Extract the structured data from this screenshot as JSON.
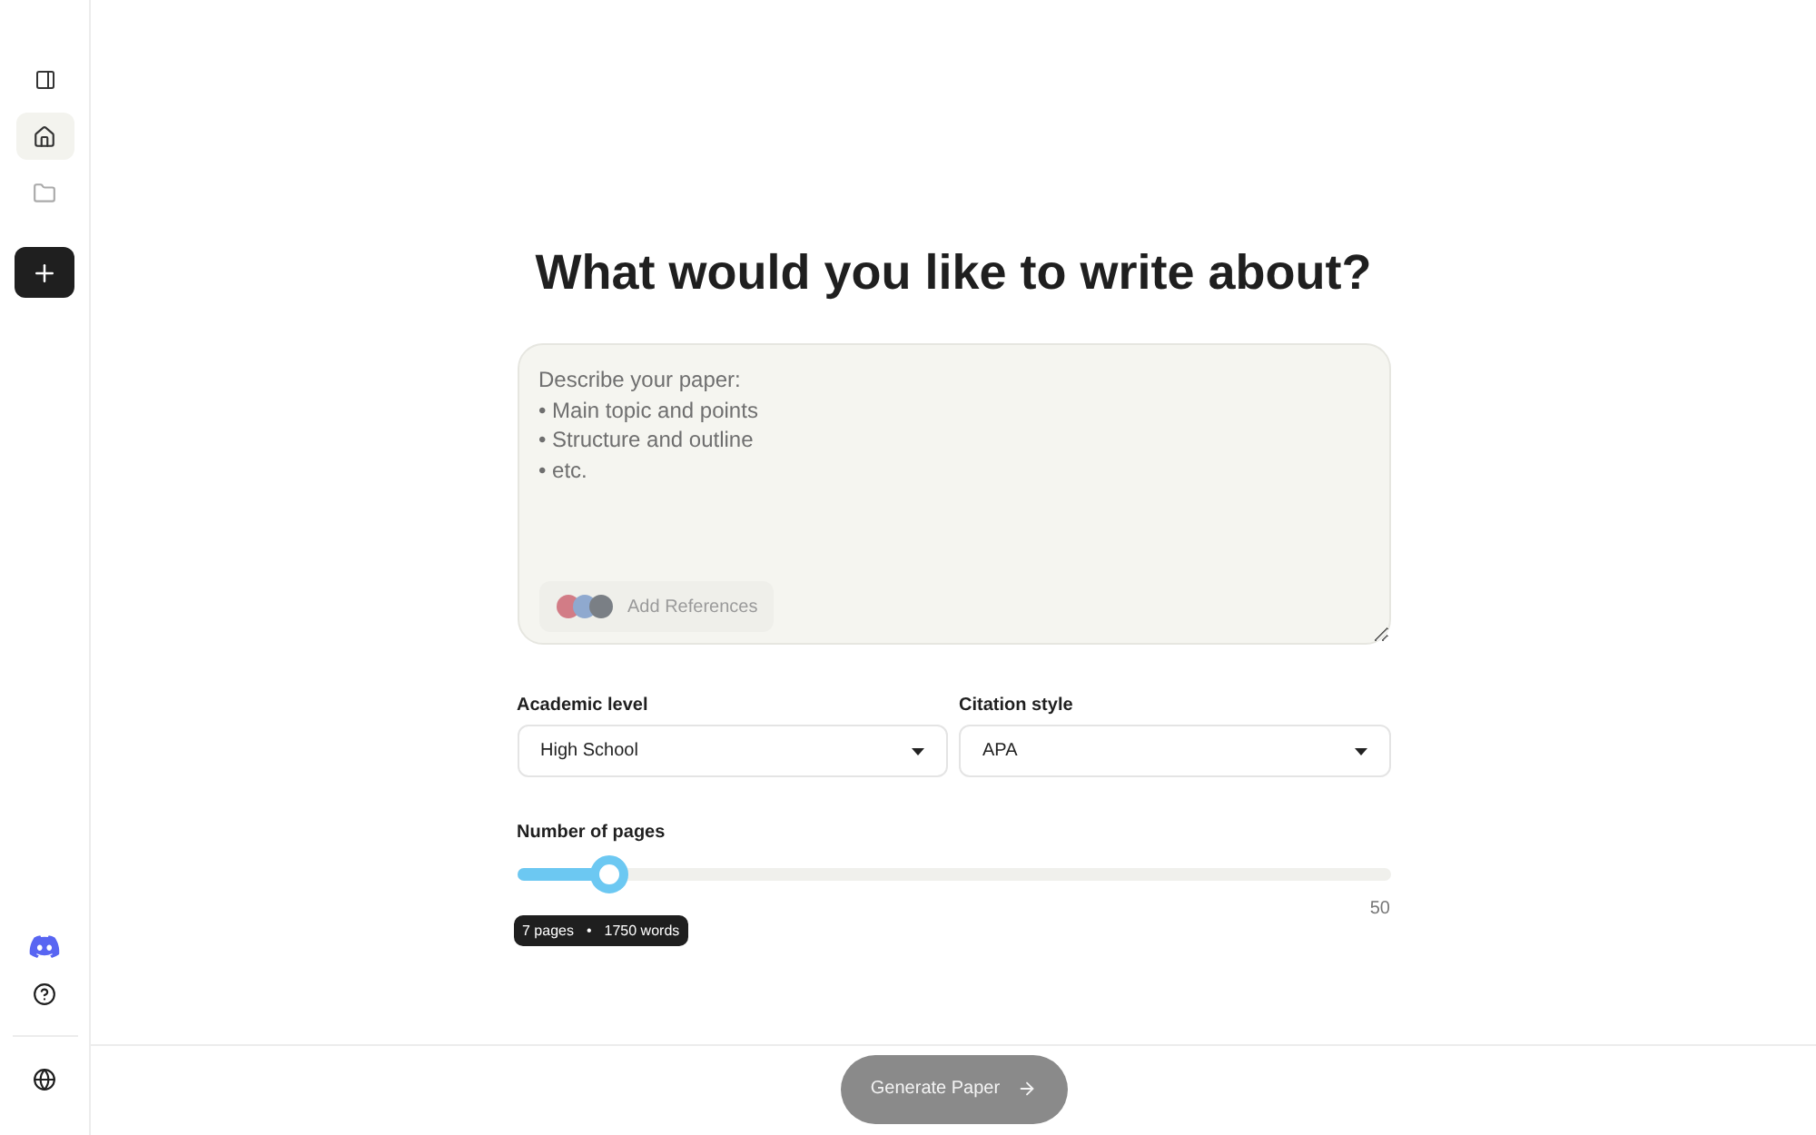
{
  "sidebar": {
    "items": [
      {
        "kind": "panel",
        "selected": false
      },
      {
        "kind": "home",
        "selected": true
      },
      {
        "kind": "folder",
        "selected": false
      }
    ],
    "bottom_items": [
      {
        "kind": "discord"
      },
      {
        "kind": "help"
      },
      {
        "kind": "globe"
      }
    ]
  },
  "heading": "What would you like to write about?",
  "description": {
    "placeholder": "Describe your paper:\n• Main topic and points\n• Structure and outline\n• etc.",
    "add_references": "Add References"
  },
  "academic_level": {
    "label": "Academic level",
    "value": "High School"
  },
  "citation_style": {
    "label": "Citation style",
    "value": "APA"
  },
  "pages": {
    "label": "Number of pages",
    "level": 0.104,
    "max": "50",
    "tooltip_pages": "7 pages",
    "tooltip_separator": "•",
    "tooltip_words": "1750 words"
  },
  "generate_button": "Generate Paper"
}
